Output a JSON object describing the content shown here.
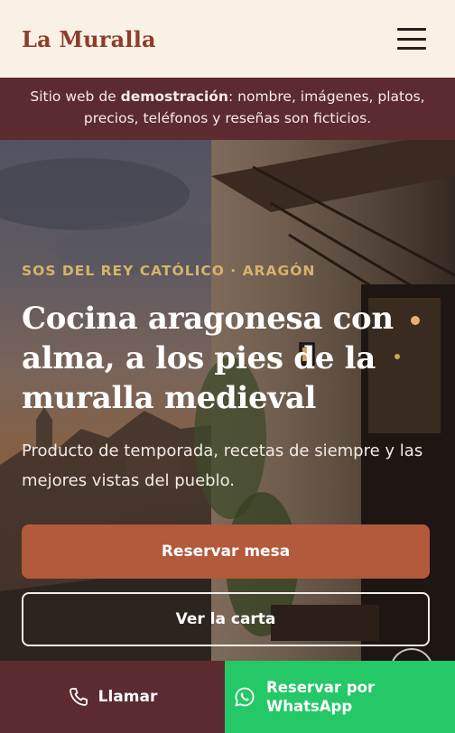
{
  "brand": {
    "name": "La Muralla"
  },
  "header": {
    "menu_icon": "hamburger-menu-icon"
  },
  "banner": {
    "prefix": "Sitio web de ",
    "bold": "demostración",
    "suffix": ": nombre, imágenes, platos, precios, teléfonos y reseñas son ficticios."
  },
  "hero": {
    "eyebrow": "SOS DEL REY CATÓLICO · ARAGÓN",
    "headline": "Cocina aragonesa con alma, a los pies de la muralla medieval",
    "subtitle": "Producto de temporada, recetas de siempre y las mejores vistas del pueblo.",
    "primary_cta": "Reservar mesa",
    "secondary_cta": "Ver la carta"
  },
  "bottom_bar": {
    "call_label": "Llamar",
    "call_icon": "phone-icon",
    "whatsapp_label": "Reservar por WhatsApp",
    "whatsapp_icon": "whatsapp-icon"
  },
  "colors": {
    "brand": "#8e3d2b",
    "banner_bg": "#5c2b30",
    "primary_button": "#b25a3b",
    "accent_gold": "#d6b46a",
    "whatsapp_green": "#25c866"
  }
}
